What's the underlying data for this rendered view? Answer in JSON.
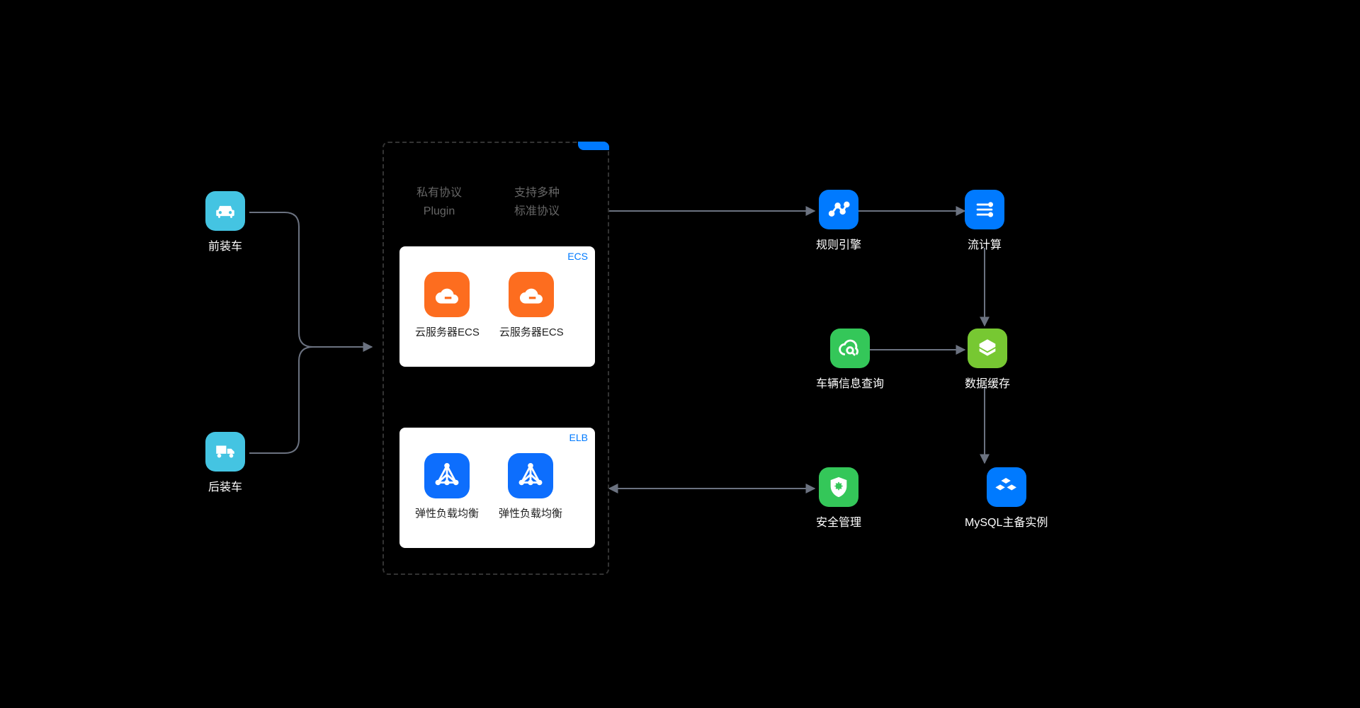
{
  "left": {
    "front_car": "前装车",
    "back_car": "后装车"
  },
  "panel": {
    "tab": "",
    "header_left_l1": "私有协议",
    "header_left_l2": "Plugin",
    "header_right_l1": "支持多种",
    "header_right_l2": "标准协议",
    "card_ecs": {
      "tag": "ECS",
      "svc1": "云服务器ECS",
      "svc2": "云服务器ECS"
    },
    "card_elb": {
      "tag": "ELB",
      "svc1": "弹性负载均衡",
      "svc2": "弹性负载均衡"
    }
  },
  "right": {
    "rule_engine": "规则引擎",
    "stream_compute": "流计算",
    "vehicle_query": "车辆信息查询",
    "data_cache": "数据缓存",
    "security": "安全管理",
    "mysql": "MySQL主备实例"
  },
  "colors": {
    "cyan": "#44c4e2",
    "blue": "#007aff",
    "orange": "#fd6d1f",
    "green": "#34c759",
    "lightgreen": "#77c832",
    "stroke": "#6b7280"
  }
}
